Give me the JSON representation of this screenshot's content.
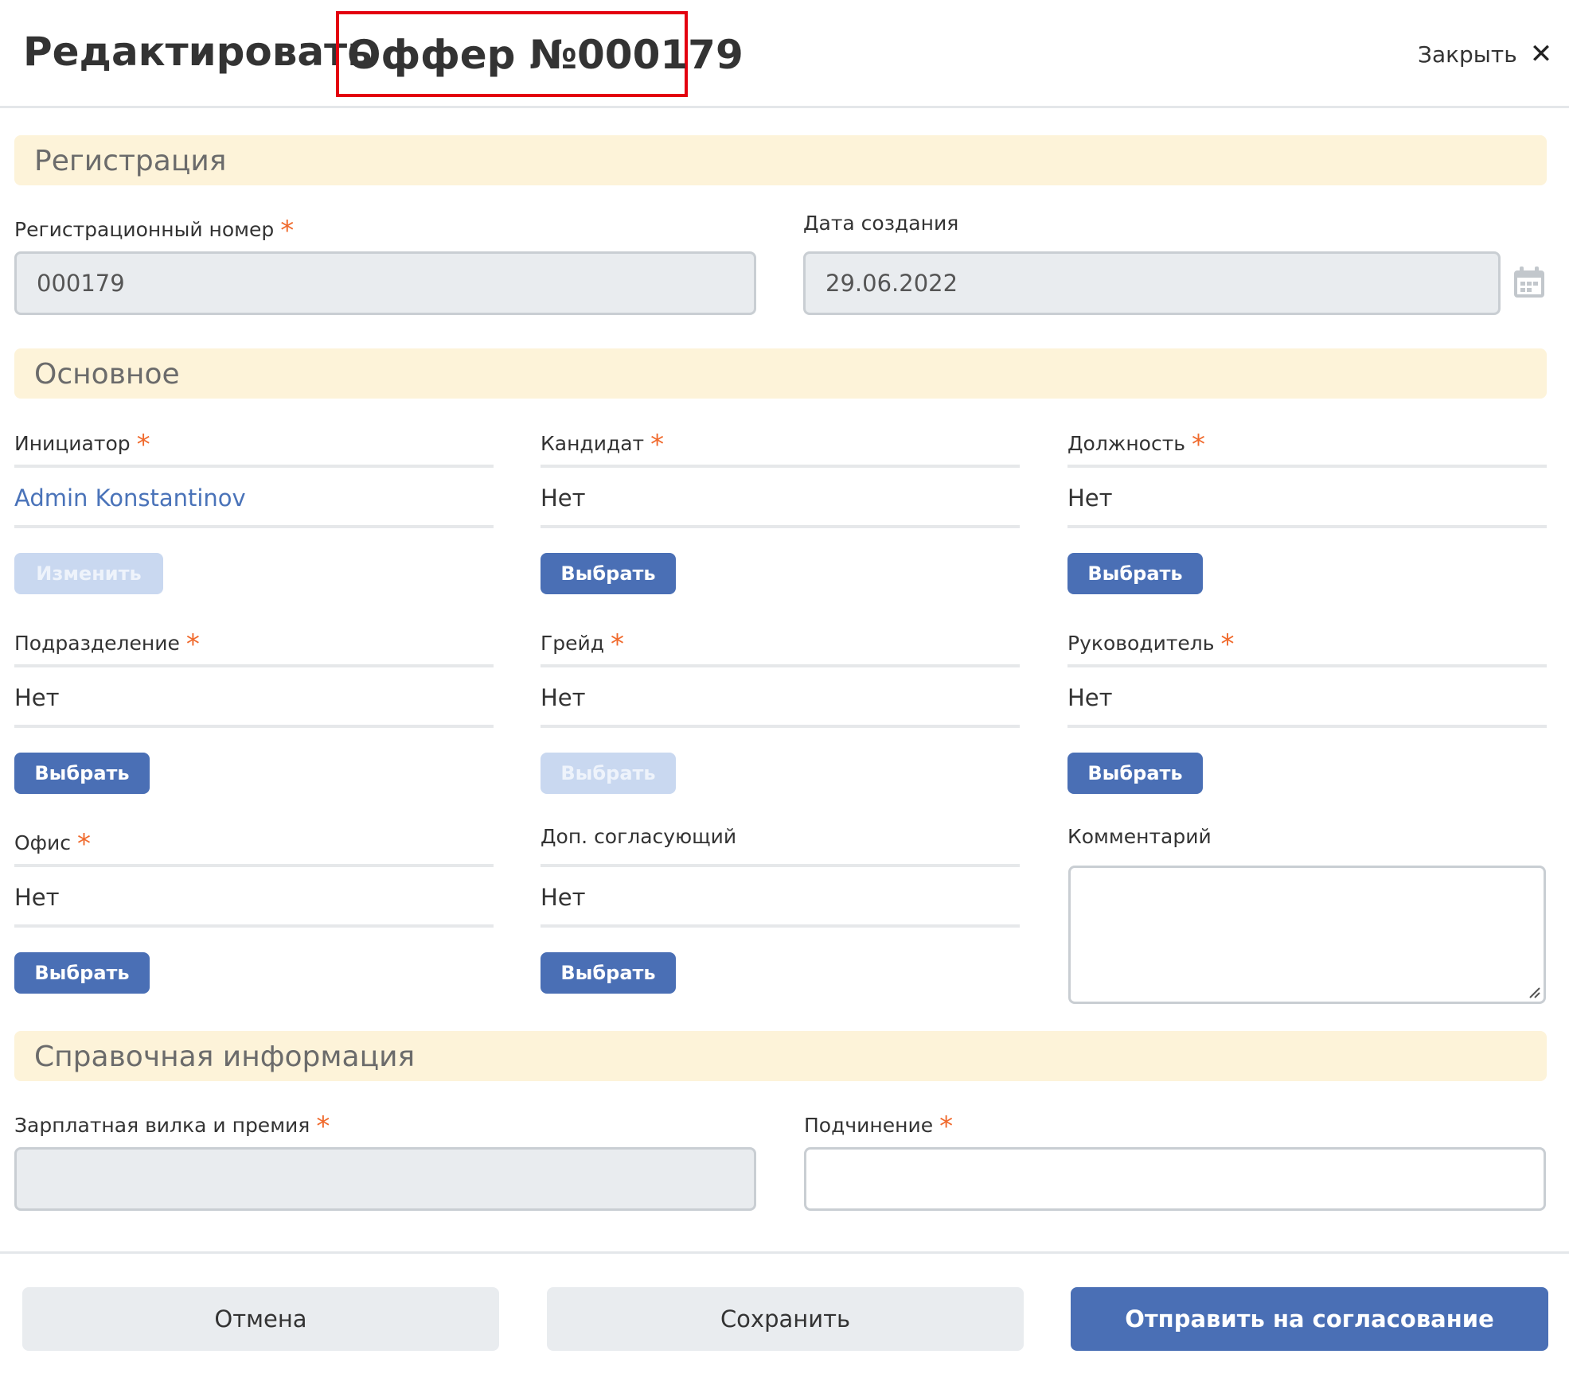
{
  "header": {
    "title_prefix": "Редактировать",
    "title_offer": "Оффер №000179",
    "close_label": "Закрыть"
  },
  "sections": {
    "registration": "Регистрация",
    "main": "Основное",
    "reference": "Справочная информация"
  },
  "registration": {
    "reg_number_label": "Регистрационный номер",
    "reg_number_value": "000179",
    "created_label": "Дата создания",
    "created_value": "29.06.2022"
  },
  "fields": {
    "initiator": {
      "label": "Инициатор",
      "value": "Admin Konstantinov",
      "button": "Изменить"
    },
    "candidate": {
      "label": "Кандидат",
      "value": "Нет",
      "button": "Выбрать"
    },
    "position": {
      "label": "Должность",
      "value": "Нет",
      "button": "Выбрать"
    },
    "department": {
      "label": "Подразделение",
      "value": "Нет",
      "button": "Выбрать"
    },
    "grade": {
      "label": "Грейд",
      "value": "Нет",
      "button": "Выбрать"
    },
    "manager": {
      "label": "Руководитель",
      "value": "Нет",
      "button": "Выбрать"
    },
    "office": {
      "label": "Офис",
      "value": "Нет",
      "button": "Выбрать"
    },
    "approver": {
      "label": "Доп. согласующий",
      "value": "Нет",
      "button": "Выбрать"
    },
    "comment": {
      "label": "Комментарий",
      "value": ""
    }
  },
  "reference": {
    "salary_label": "Зарплатная вилка и премия",
    "salary_value": "",
    "subordination_label": "Подчинение",
    "subordination_value": ""
  },
  "required_mark": "*",
  "footer": {
    "cancel": "Отмена",
    "save": "Сохранить",
    "submit": "Отправить на согласование"
  },
  "colors": {
    "accent": "#4a6fb5",
    "section_bg": "#fdf3d9",
    "required": "#f06a2d",
    "highlight_border": "#e3000f",
    "link": "#4a73b9"
  },
  "icons": {
    "close": "close-icon",
    "calendar": "calendar-icon",
    "resize": "resize-handle-icon"
  }
}
